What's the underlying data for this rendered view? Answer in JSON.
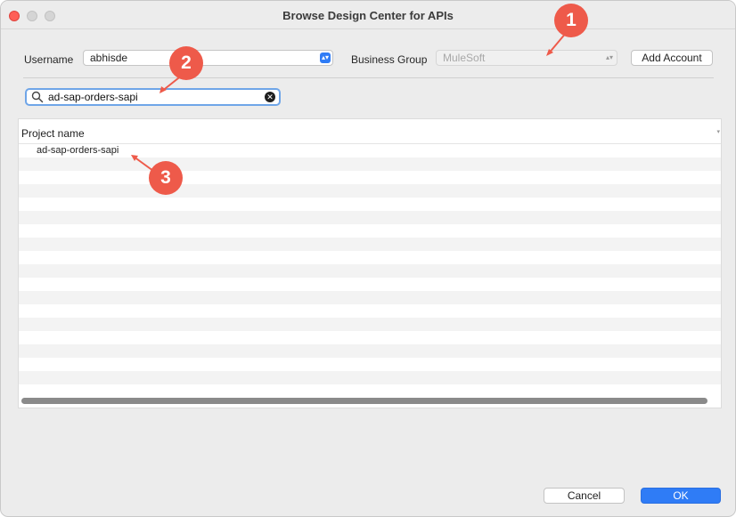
{
  "window": {
    "title": "Browse Design Center for APIs"
  },
  "form": {
    "username_label": "Username",
    "username_value": "abhisde",
    "business_group_label": "Business Group",
    "business_group_value": "MuleSoft",
    "add_account_label": "Add Account"
  },
  "search": {
    "value": "ad-sap-orders-sapi"
  },
  "table": {
    "column_header": "Project name",
    "rows": [
      "ad-sap-orders-sapi"
    ]
  },
  "footer": {
    "cancel_label": "Cancel",
    "ok_label": "OK"
  },
  "annotations": [
    "1",
    "2",
    "3"
  ],
  "colors": {
    "accent": "#2f7cf6",
    "annotation": "#ee5a4a",
    "close": "#fe5f57"
  }
}
